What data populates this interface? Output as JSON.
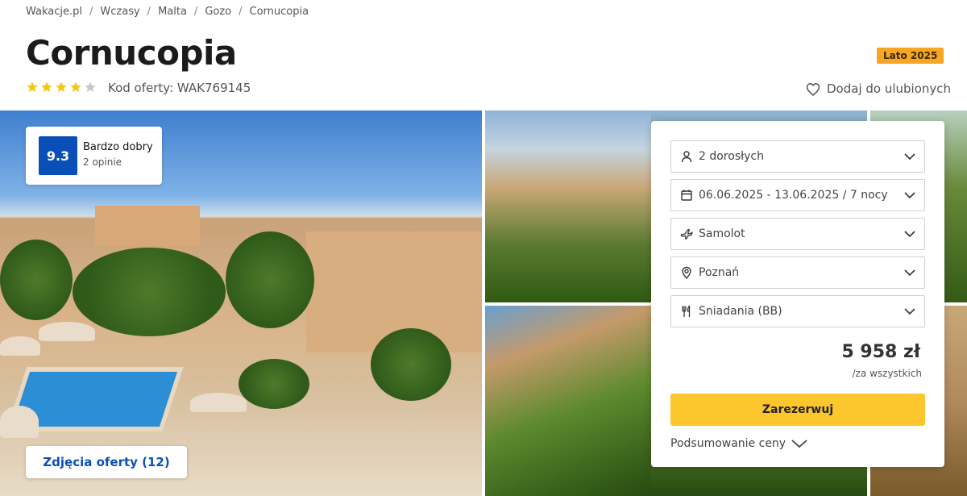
{
  "breadcrumb": [
    {
      "label": "Wakacje.pl"
    },
    {
      "label": "Wczasy"
    },
    {
      "label": "Malta"
    },
    {
      "label": "Gozo"
    },
    {
      "label": "Cornucopia"
    }
  ],
  "hotel": {
    "name": "Cornucopia",
    "season_badge": "Lato 2025",
    "stars": 4,
    "stars_max": 5,
    "offer_code": "Kod oferty: WAK769145",
    "favorite_label": "Dodaj do ulubionych"
  },
  "rating": {
    "score": "9.3",
    "label": "Bardzo dobry",
    "count": "2 opinie"
  },
  "gallery": {
    "photos_button": "Zdjęcia oferty (12)"
  },
  "booking": {
    "travelers": "2 dorosłych",
    "dates": "06.06.2025 - 13.06.2025 / 7 nocy",
    "transport": "Samolot",
    "departure": "Poznań",
    "board": "Śniadania (BB)",
    "price": "5 958 zł",
    "price_note": "/za wszystkich",
    "book_label": "Zarezerwuj",
    "summary_label": "Podsumowanie ceny"
  },
  "colors": {
    "accent_blue": "#0a4fb8",
    "book_yellow": "#fcc72c",
    "badge_orange": "#f6a623",
    "star_yellow": "#f5c518",
    "star_empty": "#c8c8c8"
  }
}
